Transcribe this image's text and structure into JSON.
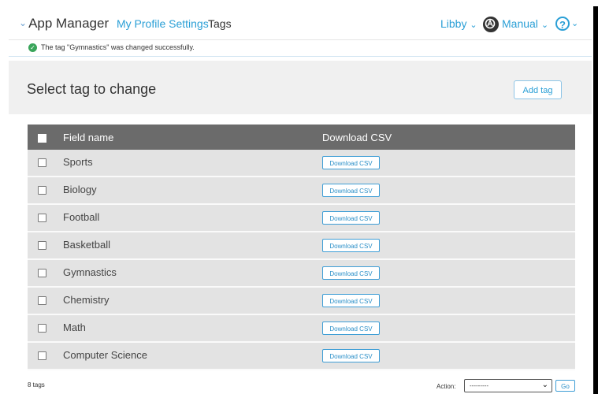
{
  "header": {
    "app_title": "App Manager",
    "app_chevron": "⌄",
    "profile_link": "My Profile Settings",
    "current_page": "Tags",
    "user_menu": "Libby",
    "manual_menu": "Manual",
    "help_symbol": "?",
    "menu_chevron": "⌄"
  },
  "message": {
    "text": "The tag \"Gymnastics\" was changed successfully.",
    "icon": "check-circle-icon",
    "color": "#3aa55b"
  },
  "page": {
    "title": "Select tag to change",
    "add_button": "Add tag"
  },
  "table": {
    "columns": [
      "Field name",
      "Download CSV"
    ],
    "rows": [
      {
        "name": "Sports",
        "button": "Download CSV"
      },
      {
        "name": "Biology",
        "button": "Download CSV"
      },
      {
        "name": "Football",
        "button": "Download CSV"
      },
      {
        "name": "Basketball",
        "button": "Download CSV"
      },
      {
        "name": "Gymnastics",
        "button": "Download CSV"
      },
      {
        "name": "Chemistry",
        "button": "Download CSV"
      },
      {
        "name": "Math",
        "button": "Download CSV"
      },
      {
        "name": "Computer Science",
        "button": "Download CSV"
      }
    ]
  },
  "footer": {
    "count_text": "8 tags",
    "action_label": "Action:",
    "action_value": "---------",
    "go_button": "Go"
  },
  "colors": {
    "accent": "#2a9fd6",
    "header_row": "#6b6b6b",
    "row_bg": "#e3e3e3",
    "title_bar": "#f0f0f0"
  }
}
